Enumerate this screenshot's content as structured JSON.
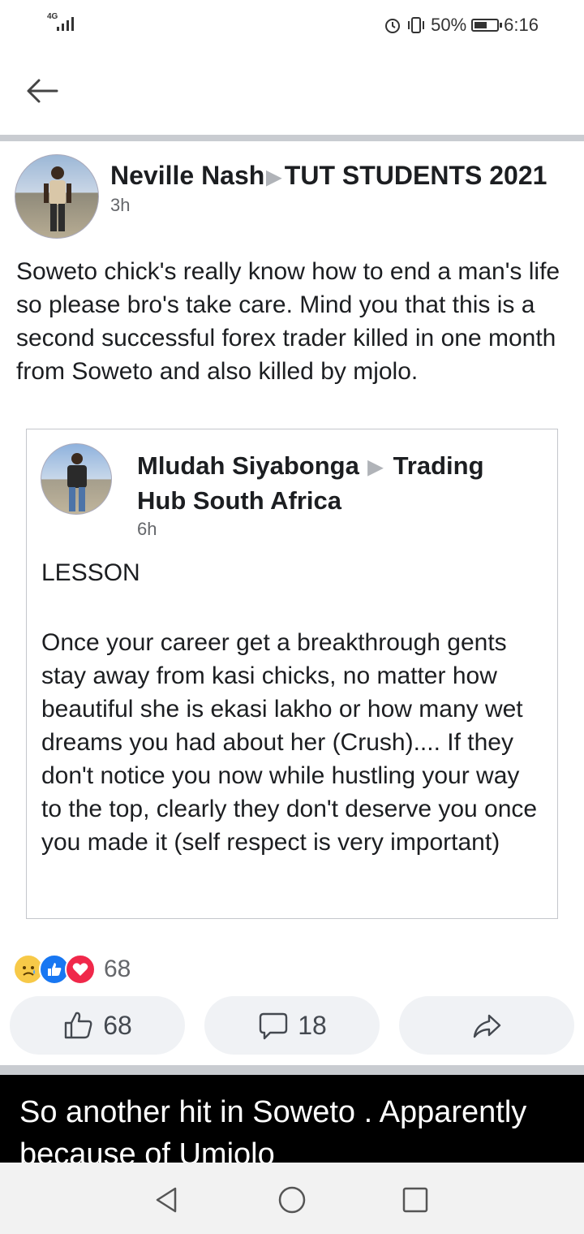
{
  "status_bar": {
    "network": "4G",
    "battery_percent": "50%",
    "battery_level": 0.5,
    "time": "6:16"
  },
  "post": {
    "author": "Neville Nash",
    "group": "TUT STUDENTS 2021",
    "time": "3h",
    "text": "Soweto chick's really know how to end a man's life so please bro's take care. Mind you that this is a second successful forex trader killed in one month from Soweto and also killed by mjolo."
  },
  "shared_post": {
    "author": "Mludah Siyabonga",
    "group": "Trading Hub South Africa",
    "time": "6h",
    "title": "LESSON",
    "body": "Once your career get a breakthrough gents stay away from kasi chicks, no matter how beautiful she is ekasi lakho or how many wet dreams you had about her (Crush).... If they don't notice you now while hustling your way to the top, clearly they don't deserve you once you made it (self respect is very important)"
  },
  "reactions": {
    "types": [
      "sad-icon",
      "like-icon",
      "love-icon"
    ],
    "total": "68"
  },
  "actions": {
    "like_count": "68",
    "comment_count": "18"
  },
  "next_post": {
    "text": "So another hit in Soweto . Apparently because of Umjolo"
  },
  "colors": {
    "facebook_blue": "#1877f2",
    "love_red": "#f0284a",
    "sad_yellow": "#f7c948",
    "button_bg": "#f0f2f5"
  }
}
